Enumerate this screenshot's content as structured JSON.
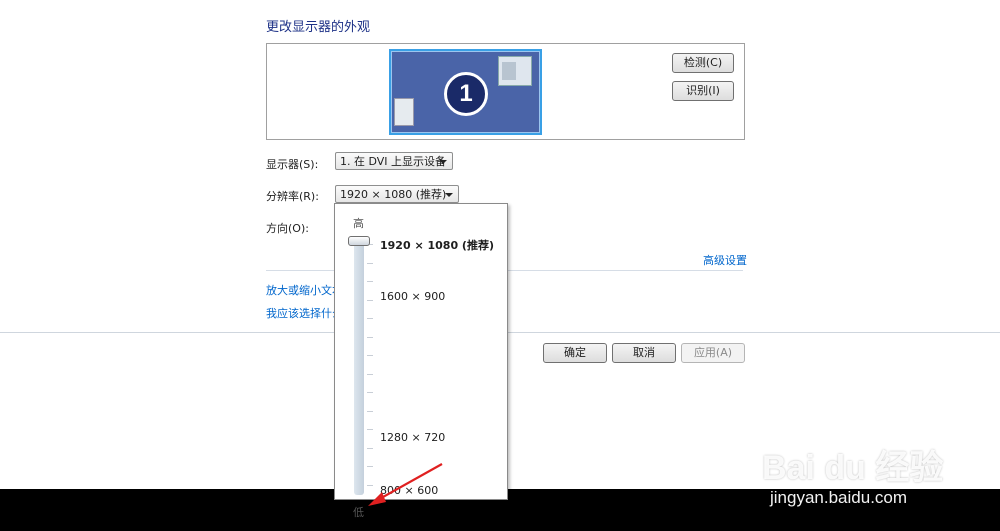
{
  "page": {
    "title": "更改显示器的外观"
  },
  "preview": {
    "monitor_number": "1",
    "detect_button": "检测(C)",
    "identify_button": "识别(I)"
  },
  "settings": {
    "display_label": "显示器(S):",
    "display_value": "1. 在 DVI 上显示设备",
    "resolution_label": "分辨率(R):",
    "resolution_value": "1920 × 1080 (推荐)",
    "orientation_label": "方向(O):",
    "advanced_link": "高级设置",
    "text_size_link": "放大或缩小文本",
    "which_choose_link": "我应该选择什么"
  },
  "dropdown": {
    "high_label": "高",
    "low_label": "低",
    "options": [
      {
        "label": "1920 × 1080 (推荐)",
        "selected": true
      },
      {
        "label": "1600 × 900",
        "selected": false
      },
      {
        "label": "1280 × 720",
        "selected": false
      },
      {
        "label": "800 × 600",
        "selected": false
      }
    ],
    "slider_level_percent": 100
  },
  "footer": {
    "ok_button": "确定",
    "cancel_button": "取消",
    "apply_button": "应用(A)"
  },
  "watermark": {
    "line1": "Bai du 经验",
    "line2": "jingyan.baidu.com"
  },
  "colors": {
    "title": "#1e3287",
    "link": "#0066cc",
    "monitor_fill": "#4a64a8",
    "monitor_border": "#39a0e6",
    "arrow": "#e02020"
  }
}
